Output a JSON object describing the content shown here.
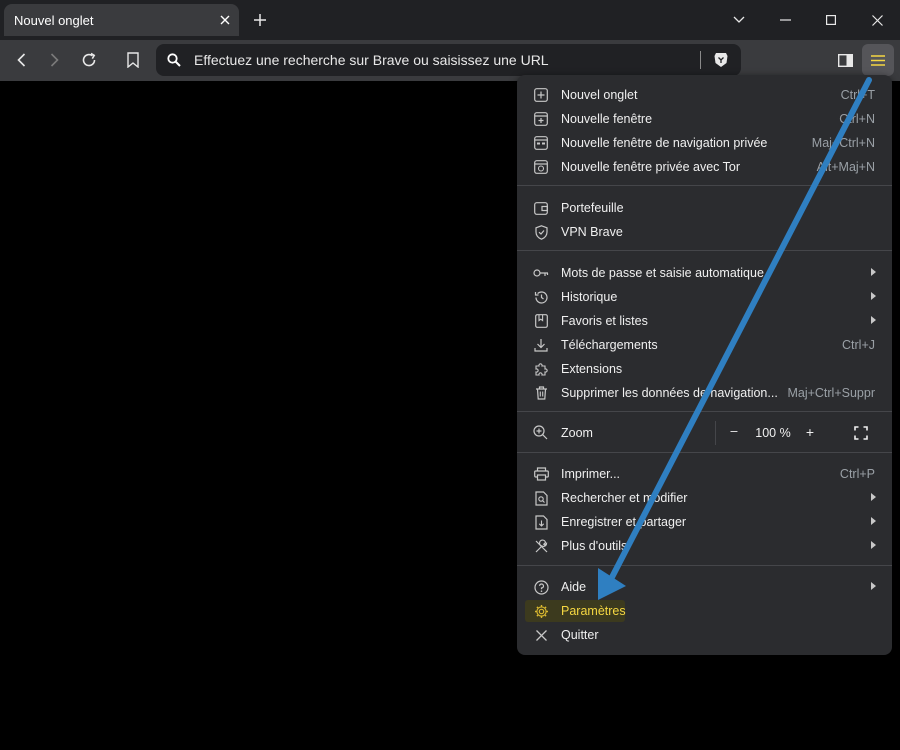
{
  "tab": {
    "title": "Nouvel onglet"
  },
  "omnibox": {
    "placeholder": "Effectuez une recherche sur Brave ou saisissez une URL"
  },
  "colors": {
    "accent": "#f5d742",
    "arrow": "#2f7fc1",
    "highlight_bg": "#3c3a1e"
  },
  "icons": {
    "tab_close": "close-icon",
    "new_tab": "plus-icon",
    "back": "back-arrow-icon",
    "forward": "forward-arrow-icon",
    "reload": "reload-icon",
    "bookmark": "bookmark-icon",
    "search": "search-icon",
    "brave_shield": "brave-lion-icon",
    "sidebar": "sidebar-icon",
    "menu": "hamburger-menu-icon"
  },
  "menu": {
    "groups": [
      {
        "items": [
          {
            "label": "Nouvel onglet",
            "shortcut": "Ctrl+T",
            "icon": "new-tab-icon"
          },
          {
            "label": "Nouvelle fenêtre",
            "shortcut": "Ctrl+N",
            "icon": "new-window-icon"
          },
          {
            "label": "Nouvelle fenêtre de navigation privée",
            "shortcut": "Maj+Ctrl+N",
            "icon": "private-window-icon"
          },
          {
            "label": "Nouvelle fenêtre privée avec Tor",
            "shortcut": "Alt+Maj+N",
            "icon": "tor-window-icon"
          }
        ]
      },
      {
        "items": [
          {
            "label": "Portefeuille",
            "icon": "wallet-icon"
          },
          {
            "label": "VPN Brave",
            "icon": "vpn-shield-icon"
          }
        ]
      },
      {
        "items": [
          {
            "label": "Mots de passe et saisie automatique",
            "submenu": true,
            "icon": "key-icon"
          },
          {
            "label": "Historique",
            "submenu": true,
            "icon": "history-icon"
          },
          {
            "label": "Favoris et listes",
            "submenu": true,
            "icon": "bookmarks-icon"
          },
          {
            "label": "Téléchargements",
            "shortcut": "Ctrl+J",
            "icon": "download-icon"
          },
          {
            "label": "Extensions",
            "icon": "puzzle-icon"
          },
          {
            "label": "Supprimer les données de navigation...",
            "shortcut": "Maj+Ctrl+Suppr",
            "icon": "trash-icon"
          }
        ]
      },
      {
        "zoom": {
          "label": "Zoom",
          "minus": "–",
          "value": "100 %",
          "plus": "+",
          "icon": "zoom-icon",
          "fullscreen_icon": "fullscreen-icon"
        }
      },
      {
        "items": [
          {
            "label": "Imprimer...",
            "shortcut": "Ctrl+P",
            "icon": "print-icon"
          },
          {
            "label": "Rechercher et modifier",
            "submenu": true,
            "icon": "find-icon"
          },
          {
            "label": "Enregistrer et partager",
            "submenu": true,
            "icon": "save-share-icon"
          },
          {
            "label": "Plus d'outils",
            "submenu": true,
            "icon": "tools-icon"
          }
        ]
      },
      {
        "items": [
          {
            "label": "Aide",
            "submenu": true,
            "icon": "help-icon"
          },
          {
            "label": "Paramètres",
            "icon": "gear-icon",
            "highlighted": true
          },
          {
            "label": "Quitter",
            "icon": "close-icon"
          }
        ]
      }
    ]
  }
}
